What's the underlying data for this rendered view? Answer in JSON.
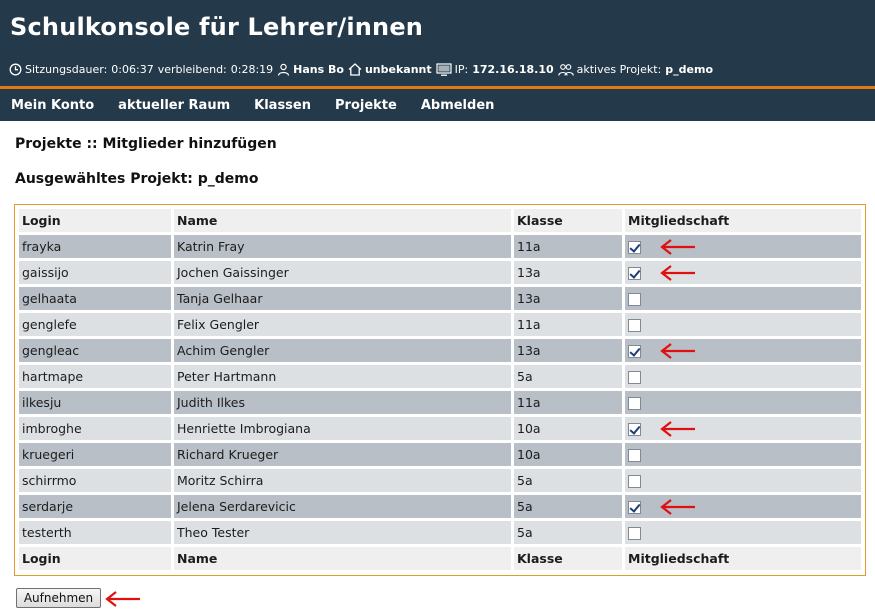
{
  "header": {
    "title": "Schulkonsole für Lehrer/innen",
    "session_label": "Sitzungsdauer:",
    "session_value": "0:06:37",
    "remaining_label": "verbleibend:",
    "remaining_value": "0:28:19",
    "user": "Hans Bo",
    "room": "unbekannt",
    "ip_label": "IP:",
    "ip": "172.16.18.10",
    "project_label": "aktives Projekt:",
    "project": "p_demo"
  },
  "nav": {
    "items": [
      "Mein Konto",
      "aktueller Raum",
      "Klassen",
      "Projekte",
      "Abmelden"
    ]
  },
  "page": {
    "heading": "Projekte :: Mitglieder hinzufügen",
    "project_heading": "Ausgewähltes Projekt: p_demo"
  },
  "table": {
    "columns": [
      "Login",
      "Name",
      "Klasse",
      "Mitgliedschaft"
    ],
    "rows": [
      {
        "login": "frayka",
        "name": "Katrin Fray",
        "klasse": "11a",
        "member": true
      },
      {
        "login": "gaissijo",
        "name": "Jochen Gaissinger",
        "klasse": "13a",
        "member": true
      },
      {
        "login": "gelhaata",
        "name": "Tanja Gelhaar",
        "klasse": "13a",
        "member": false
      },
      {
        "login": "genglefe",
        "name": "Felix Gengler",
        "klasse": "11a",
        "member": false
      },
      {
        "login": "gengleac",
        "name": "Achim Gengler",
        "klasse": "13a",
        "member": true
      },
      {
        "login": "hartmape",
        "name": "Peter Hartmann",
        "klasse": "5a",
        "member": false
      },
      {
        "login": "ilkesju",
        "name": "Judith Ilkes",
        "klasse": "11a",
        "member": false
      },
      {
        "login": "imbroghe",
        "name": "Henriette Imbrogiana",
        "klasse": "10a",
        "member": true
      },
      {
        "login": "kruegeri",
        "name": "Richard Krueger",
        "klasse": "10a",
        "member": false
      },
      {
        "login": "schirrmo",
        "name": "Moritz Schirra",
        "klasse": "5a",
        "member": false
      },
      {
        "login": "serdarje",
        "name": "Jelena Serdarevicic",
        "klasse": "5a",
        "member": true
      },
      {
        "login": "testerth",
        "name": "Theo Tester",
        "klasse": "5a",
        "member": false
      }
    ]
  },
  "actions": {
    "submit_label": "Aufnehmen"
  },
  "colors": {
    "header_bg": "#243a4a",
    "accent_line": "#e07b12",
    "row_dark": "#b8bfc6",
    "row_light": "#dde0e3",
    "annotation_arrow": "#e01010"
  },
  "icons": [
    "clock-icon",
    "user-icon",
    "home-icon",
    "monitor-icon",
    "project-users-icon"
  ]
}
